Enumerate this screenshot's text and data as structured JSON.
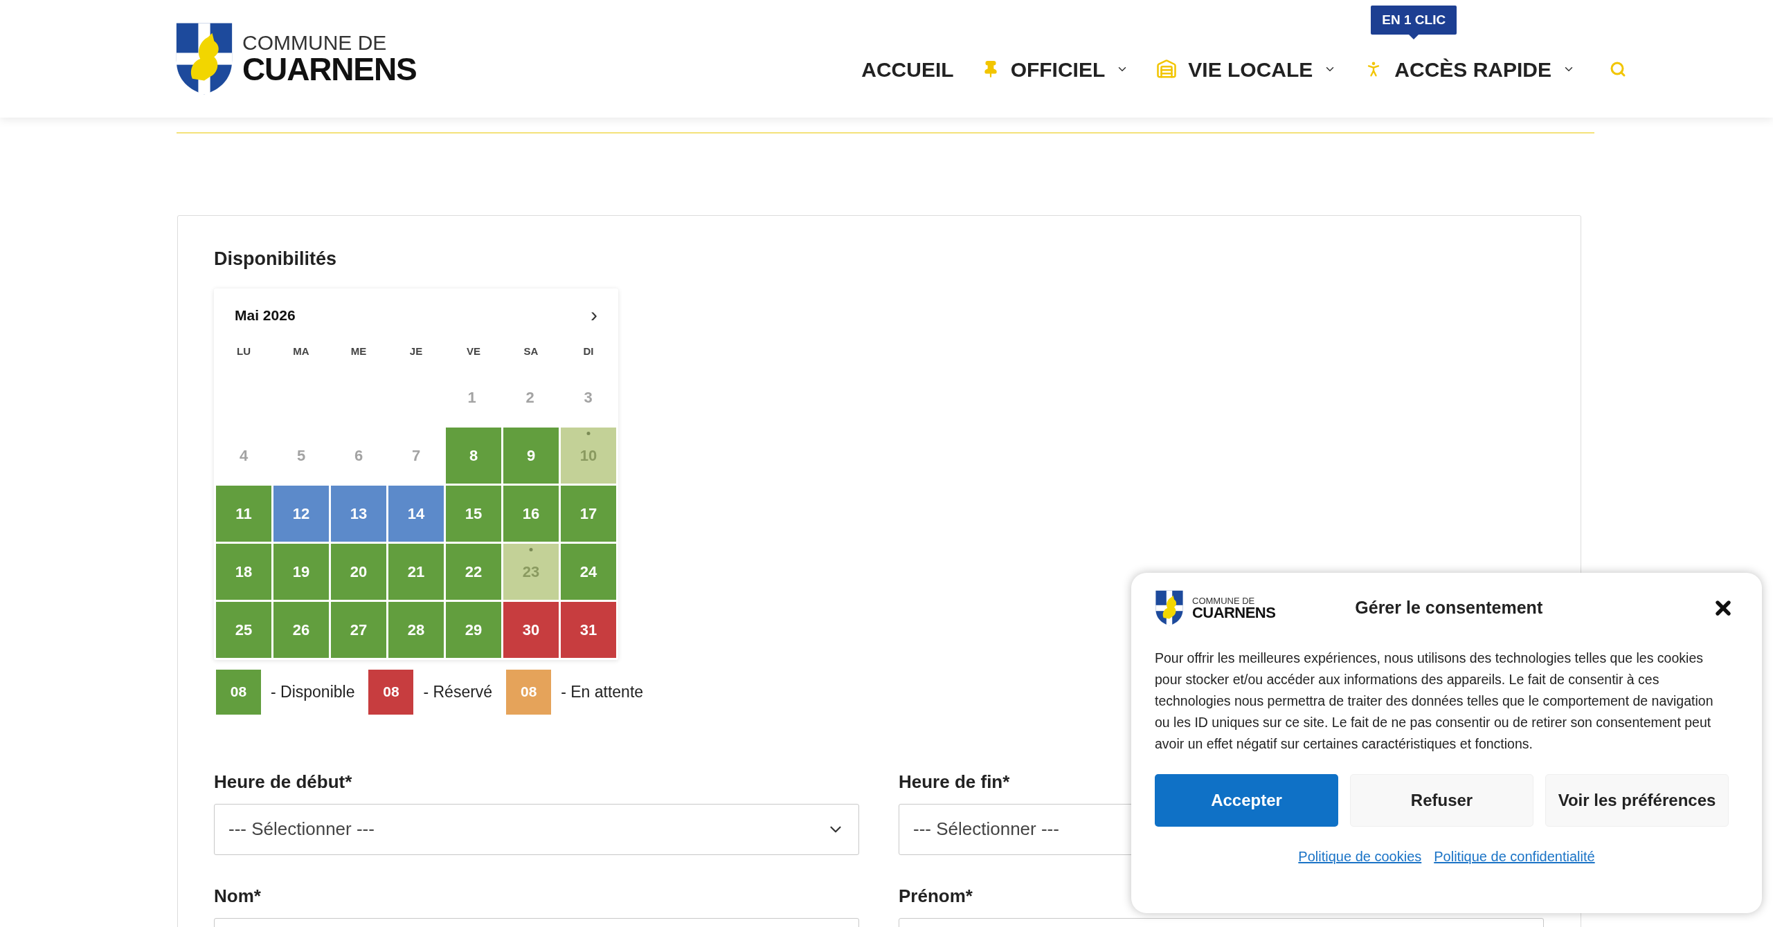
{
  "header": {
    "logo": {
      "line1": "COMMUNE DE",
      "line2": "CUARNENS"
    },
    "nav": [
      {
        "label": "ACCUEIL",
        "dropdown": false
      },
      {
        "label": "OFFICIEL",
        "dropdown": true
      },
      {
        "label": "VIE LOCALE",
        "dropdown": true
      },
      {
        "label": "ACCÈS RAPIDE",
        "dropdown": true,
        "badge": "EN 1 CLIC"
      }
    ]
  },
  "availability": {
    "title": "Disponibilités",
    "month": "Mai 2026",
    "next": "›",
    "weekdays": [
      "LU",
      "MA",
      "ME",
      "JE",
      "VE",
      "SA",
      "DI"
    ],
    "weeks": [
      {
        "days": [
          {
            "n": "1",
            "kind": "past"
          },
          {
            "n": "2",
            "kind": "past"
          },
          {
            "n": "3",
            "kind": "past"
          }
        ]
      },
      {
        "days": [
          {
            "n": "4",
            "kind": "past"
          },
          {
            "n": "5",
            "kind": "past"
          },
          {
            "n": "6",
            "kind": "past"
          },
          {
            "n": "7",
            "kind": "past"
          },
          {
            "n": "8",
            "kind": "available"
          },
          {
            "n": "9",
            "kind": "available"
          },
          {
            "n": "10",
            "kind": "partial"
          }
        ]
      },
      {
        "days": [
          {
            "n": "11",
            "kind": "available"
          },
          {
            "n": "12",
            "kind": "selected"
          },
          {
            "n": "13",
            "kind": "selected"
          },
          {
            "n": "14",
            "kind": "selected"
          },
          {
            "n": "15",
            "kind": "available"
          },
          {
            "n": "16",
            "kind": "available"
          },
          {
            "n": "17",
            "kind": "available"
          }
        ]
      },
      {
        "days": [
          {
            "n": "18",
            "kind": "available"
          },
          {
            "n": "19",
            "kind": "available"
          },
          {
            "n": "20",
            "kind": "available"
          },
          {
            "n": "21",
            "kind": "available"
          },
          {
            "n": "22",
            "kind": "available"
          },
          {
            "n": "23",
            "kind": "partial"
          },
          {
            "n": "24",
            "kind": "available"
          }
        ]
      },
      {
        "days": [
          {
            "n": "25",
            "kind": "available"
          },
          {
            "n": "26",
            "kind": "available"
          },
          {
            "n": "27",
            "kind": "available"
          },
          {
            "n": "28",
            "kind": "available"
          },
          {
            "n": "29",
            "kind": "available"
          },
          {
            "n": "30",
            "kind": "reserved"
          },
          {
            "n": "31",
            "kind": "reserved"
          }
        ]
      }
    ],
    "legend": [
      {
        "sample": "08",
        "label": "- Disponible",
        "color": "#629e3e"
      },
      {
        "sample": "08",
        "label": "- Réservé",
        "color": "#c73d3f"
      },
      {
        "sample": "08",
        "label": "- En attente",
        "color": "#e5a35a"
      }
    ]
  },
  "form": [
    {
      "label": "Heure de début*",
      "kind": "select",
      "placeholder": "--- Sélectionner ---"
    },
    {
      "label": "Heure de fin*",
      "kind": "select",
      "placeholder": "--- Sélectionner ---"
    },
    {
      "label": "Nom*",
      "kind": "text"
    },
    {
      "label": "Prénom*",
      "kind": "text"
    }
  ],
  "consent": {
    "logo": {
      "line1": "COMMUNE DE",
      "line2": "CUARNENS"
    },
    "title": "Gérer le consentement",
    "text": "Pour offrir les meilleures expériences, nous utilisons des technologies telles que les cookies pour stocker et/ou accéder aux informations des appareils. Le fait de consentir à ces technologies nous permettra de traiter des données telles que le comportement de navigation ou les ID uniques sur ce site. Le fait de ne pas consentir ou de retirer son consentement peut avoir un effet négatif sur certaines caractéristiques et fonctions.",
    "buttons": [
      {
        "label": "Accepter",
        "primary": true
      },
      {
        "label": "Refuser",
        "primary": false
      },
      {
        "label": "Voir les préférences",
        "primary": false
      }
    ],
    "links": [
      "Politique de cookies",
      "Politique de confidentialité"
    ]
  }
}
